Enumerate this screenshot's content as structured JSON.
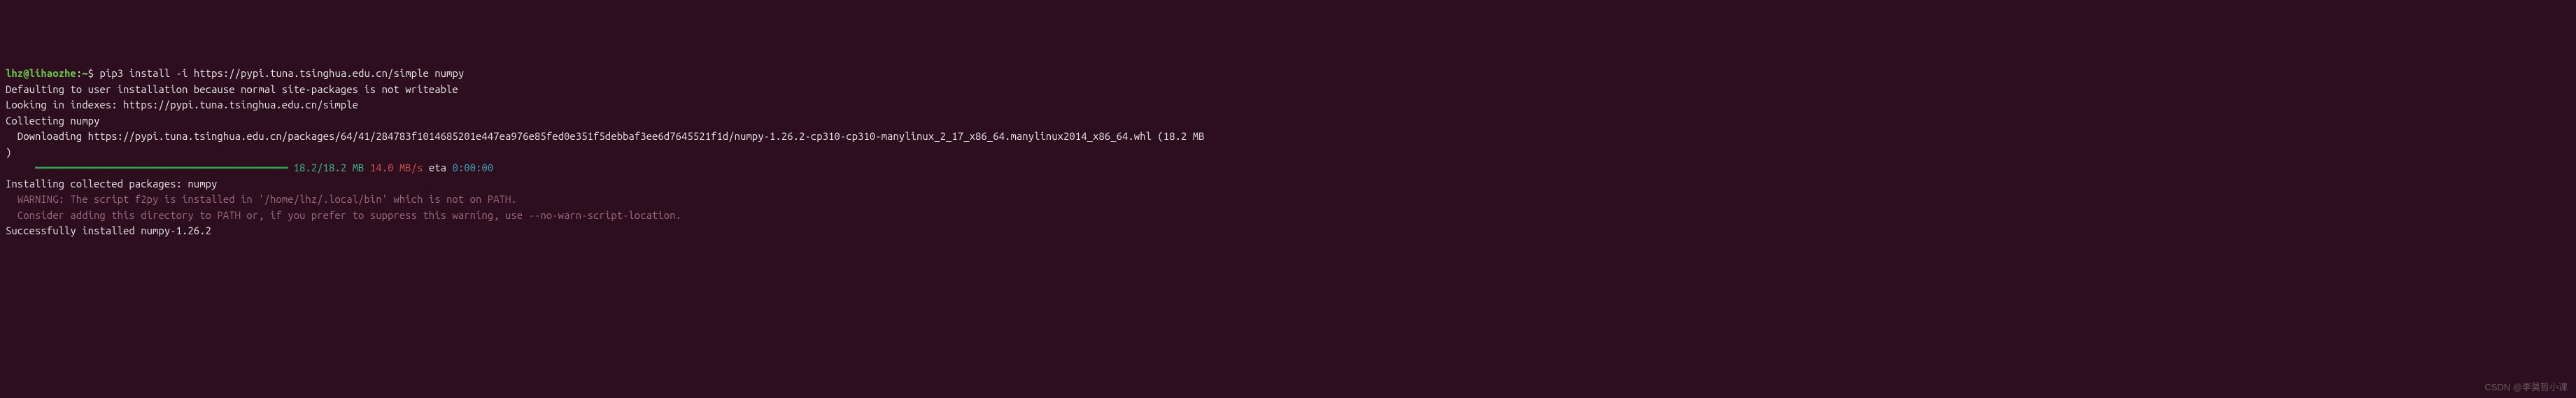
{
  "prompt": {
    "user_host": "lhz@lihaozhe",
    "separator": ":",
    "path": "~",
    "symbol": "$",
    "command": "pip3 install -i https://pypi.tuna.tsinghua.edu.cn/simple numpy"
  },
  "output": {
    "default_msg": "Defaulting to user installation because normal site-packages is not writeable",
    "indexes": "Looking in indexes: https://pypi.tuna.tsinghua.edu.cn/simple",
    "collecting": "Collecting numpy",
    "downloading": "  Downloading https://pypi.tuna.tsinghua.edu.cn/packages/64/41/284783f1014685201e447ea976e85fed0e351f5debbaf3ee6d7645521f1d/numpy-1.26.2-cp310-cp310-manylinux_2_17_x86_64.manylinux2014_x86_64.whl (18.2 MB",
    "closing_paren": ")",
    "progress": {
      "bar": "     ━━━━━━━━━━━━━━━━━━━━━━━━━━━━━━━━━━━━━━━━",
      "size": " 18.2/18.2 MB",
      "speed": " 14.0 MB/s",
      "eta_label": " eta",
      "eta": " 0:00:00"
    },
    "installing": "Installing collected packages: numpy",
    "warning1": "  WARNING: The script f2py is installed in '/home/lhz/.local/bin' which is not on PATH.",
    "warning2": "  Consider adding this directory to PATH or, if you prefer to suppress this warning, use --no-warn-script-location.",
    "success": "Successfully installed numpy-1.26.2"
  },
  "watermark": "CSDN @李昊哲小课"
}
